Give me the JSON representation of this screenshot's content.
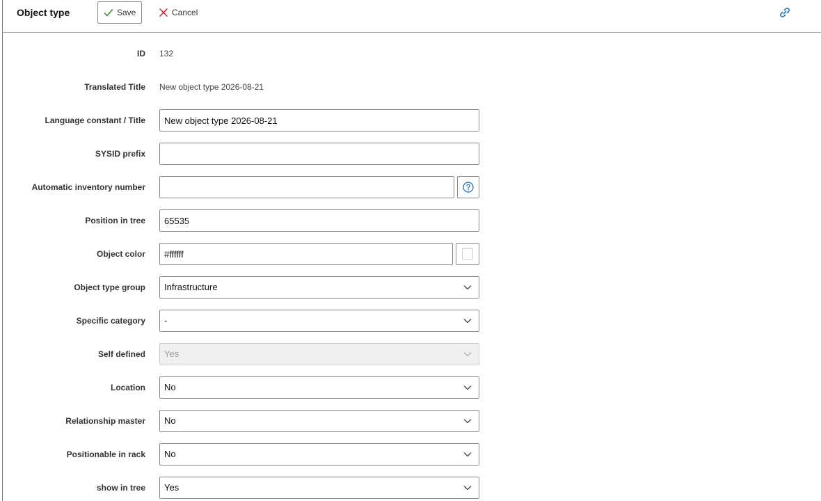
{
  "header": {
    "title": "Object type",
    "save_label": "Save",
    "cancel_label": "Cancel"
  },
  "fields": {
    "id": {
      "label": "ID",
      "value": "132"
    },
    "translated_title": {
      "label": "Translated Title",
      "value": "New object type 2026-08-21"
    },
    "language_constant": {
      "label": "Language constant / Title",
      "value": "New object type 2026-08-21"
    },
    "sysid_prefix": {
      "label": "SYSID prefix",
      "value": ""
    },
    "auto_inventory": {
      "label": "Automatic inventory number",
      "value": ""
    },
    "position_in_tree": {
      "label": "Position in tree",
      "value": "65535"
    },
    "object_color": {
      "label": "Object color",
      "value": "#ffffff"
    },
    "object_type_group": {
      "label": "Object type group",
      "value": "Infrastructure"
    },
    "specific_category": {
      "label": "Specific category",
      "value": "-"
    },
    "self_defined": {
      "label": "Self defined",
      "value": "Yes"
    },
    "location": {
      "label": "Location",
      "value": "No"
    },
    "relationship_master": {
      "label": "Relationship master",
      "value": "No"
    },
    "positionable_in_rack": {
      "label": "Positionable in rack",
      "value": "No"
    },
    "show_in_tree": {
      "label": "show in tree",
      "value": "Yes"
    }
  },
  "colors": {
    "accent": "#1a6fb3",
    "save_check": "#2e8b3a",
    "cancel_x": "#d21f1f"
  },
  "icons": {
    "save": "check-icon",
    "cancel": "close-icon",
    "link": "link-icon",
    "help": "help-icon",
    "dropdown": "chevron-down-icon"
  }
}
